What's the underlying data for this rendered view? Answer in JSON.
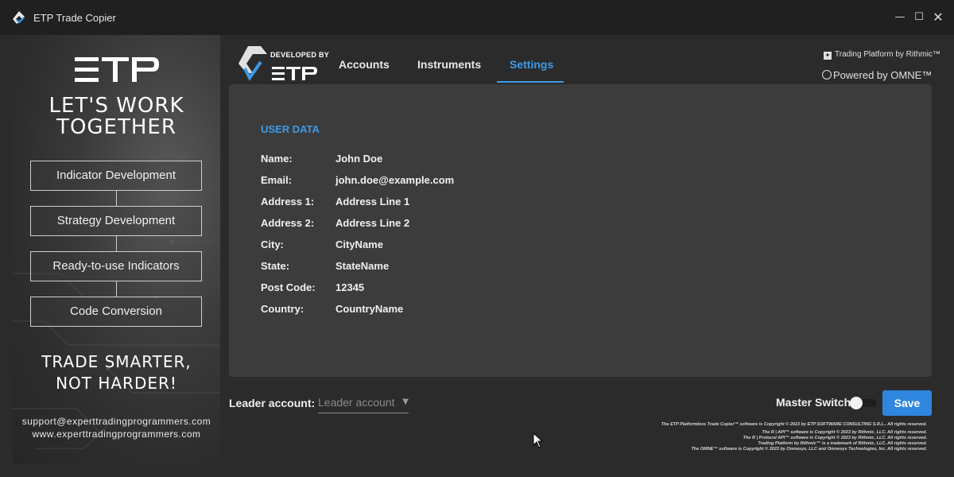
{
  "window": {
    "title": "ETP Trade Copier",
    "min_glyph": "—",
    "max_glyph": "☐",
    "close_glyph": "✕"
  },
  "sidebar": {
    "headline": [
      "LET'S WORK",
      "TOGETHER"
    ],
    "services": [
      "Indicator Development",
      "Strategy Development",
      "Ready-to-use Indicators",
      "Code Conversion"
    ],
    "slogan": [
      "TRADE SMARTER,",
      "NOT HARDER!"
    ],
    "email": "support@experttradingprogrammers.com",
    "website": "www.experttradingprogrammers.com"
  },
  "header": {
    "developed_by": "DEVELOPED BY",
    "tabs": [
      {
        "label": "Accounts",
        "active": false
      },
      {
        "label": "Instruments",
        "active": false
      },
      {
        "label": "Settings",
        "active": true
      }
    ],
    "rithmic": "Trading Platform by Rithmic™",
    "omne": "Powered by OMNE™"
  },
  "user_data": {
    "section_title": "USER DATA",
    "fields": [
      {
        "label": "Name:",
        "value": "John Doe"
      },
      {
        "label": "Email:",
        "value": "john.doe@example.com"
      },
      {
        "label": "Address 1:",
        "value": "Address Line 1"
      },
      {
        "label": "Address 2:",
        "value": "Address Line 2"
      },
      {
        "label": "City:",
        "value": "CityName"
      },
      {
        "label": "State:",
        "value": "StateName"
      },
      {
        "label": "Post Code:",
        "value": "12345"
      },
      {
        "label": "Country:",
        "value": "CountryName"
      }
    ]
  },
  "footer": {
    "leader_label": "Leader account:",
    "leader_placeholder": "Leader account",
    "master_switch_label": "Master Switch",
    "master_switch_on": false,
    "save_label": "Save",
    "copyright": [
      "The ETP Platformless Trade Copier™ software is Copyright © 2023 by ETP SOFTWARE CONSULTING S.R.L.. All rights reserved.",
      "The R | API™ software is Copyright © 2023 by Rithmic, LLC. All rights reserved.",
      "The R | Protocol API™ software is Copyright © 2023 by Rithmic, LLC. All rights reserved.",
      "Trading Platform by Rithmic™ is a trademark of Rithmic, LLC. All rights reserved.",
      "The OMNE™ software is Copyright © 2023 by Omnesys, LLC and Omnesys Technologies, Inc. All rights reserved."
    ]
  },
  "colors": {
    "accent": "#3d9be9",
    "save_button": "#2f86de",
    "panel": "#3c3c3c",
    "background": "#2b2b2b"
  },
  "icons": [
    "app-logo-icon",
    "etp-logo-icon",
    "etp-developed-logo-icon",
    "rithmic-icon",
    "omne-icon",
    "mouse-cursor-icon",
    "caret-down-icon"
  ]
}
